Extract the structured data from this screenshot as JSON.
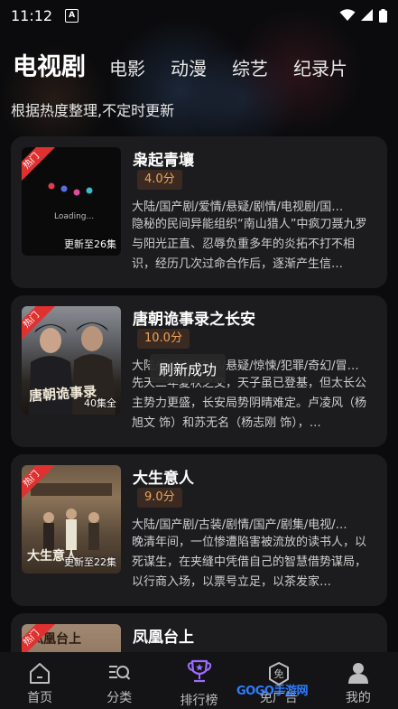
{
  "status_bar": {
    "time": "11:12"
  },
  "tabs": [
    {
      "label": "电视剧",
      "active": true
    },
    {
      "label": "电影",
      "active": false
    },
    {
      "label": "动漫",
      "active": false
    },
    {
      "label": "综艺",
      "active": false
    },
    {
      "label": "纪录片",
      "active": false
    }
  ],
  "subtitle": "根据热度整理,不定时更新",
  "hot_label": "热门",
  "items": [
    {
      "title": "枭起青壤",
      "score": "4.0分",
      "tags": "大陆/国产剧/爱情/悬疑/剧情/电视剧/国…",
      "description": "隐秘的民间异能组织“南山猎人”中疯刀聂九罗与阳光正直、忍辱负重多年的炎拓不打不相识，经历几次过命合作后，逐渐产生信…",
      "episode": "更新至26集",
      "loading_text": "Loading..."
    },
    {
      "title": "唐朝诡事录之长安",
      "score": "10.0分",
      "tags": "大陆/国产剧/古装/悬疑/惊悚/犯罪/奇幻/冒…",
      "description": "先天二年夏秋之交，天子虽已登基，但太长公主势力更盛，长安局势阴晴难定。卢凌风（杨旭文 饰）和苏无名（杨志刚 饰），…",
      "episode": "40集全",
      "poster_text": "唐朝诡事录"
    },
    {
      "title": "大生意人",
      "score": "9.0分",
      "tags": "大陆/国产剧/古装/剧情/国产/剧集/电视/…",
      "description": "晚清年间，一位惨遭陷害被流放的读书人，以死谋生，在夹缝中凭借自己的智慧借势谋局，以行商入场，以票号立足，以茶发家…",
      "episode": "更新至22集",
      "poster_text": "大生意人"
    },
    {
      "title": "凤凰台上",
      "poster_text": "凤凰台上"
    }
  ],
  "toast": "刷新成功",
  "bottom_nav": [
    {
      "label": "首页",
      "icon": "home-icon"
    },
    {
      "label": "分类",
      "icon": "category-search-icon"
    },
    {
      "label": "排行榜",
      "icon": "ranking-trophy-icon",
      "active": true
    },
    {
      "label": "免广告",
      "icon": "ad-free-icon"
    },
    {
      "label": "我的",
      "icon": "profile-icon"
    }
  ],
  "watermark": "GOGO手游网"
}
